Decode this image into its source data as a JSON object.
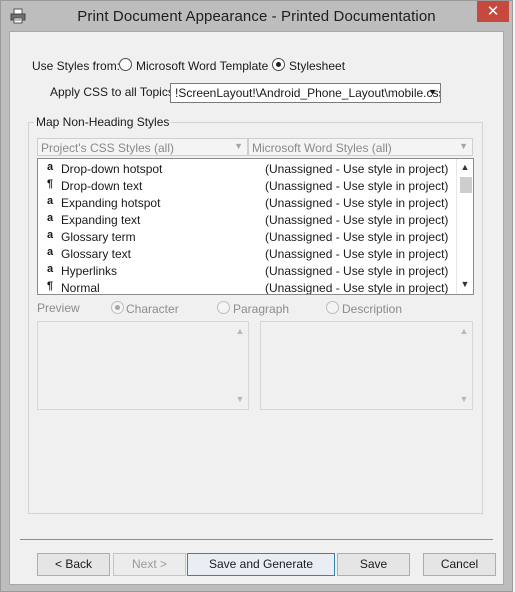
{
  "window": {
    "title": "Print Document Appearance - Printed Documentation",
    "close_label": "✕"
  },
  "use_styles": {
    "label": "Use Styles from:",
    "options": [
      {
        "label": "Microsoft Word Template",
        "checked": false
      },
      {
        "label": "Stylesheet",
        "checked": true
      }
    ]
  },
  "apply_css": {
    "label": "Apply CSS to all Topics:",
    "value": "!ScreenLayout!\\Android_Phone_Layout\\mobile.css"
  },
  "map_group": {
    "title": "Map Non-Heading Styles",
    "css_styles_filter": "Project's CSS Styles (all)",
    "word_styles_filter": "Microsoft Word Styles (all)",
    "rows": [
      {
        "icon": "character-style-icon",
        "glyph": "a",
        "name": "Drop-down hotspot",
        "style": "(Unassigned - Use style in project)"
      },
      {
        "icon": "paragraph-style-icon",
        "glyph": "¶",
        "name": "Drop-down text",
        "style": "(Unassigned - Use style in project)"
      },
      {
        "icon": "character-style-icon",
        "glyph": "a",
        "name": "Expanding hotspot",
        "style": "(Unassigned - Use style in project)"
      },
      {
        "icon": "character-style-icon",
        "glyph": "a",
        "name": "Expanding text",
        "style": "(Unassigned - Use style in project)"
      },
      {
        "icon": "character-style-icon",
        "glyph": "a",
        "name": "Glossary term",
        "style": "(Unassigned - Use style in project)"
      },
      {
        "icon": "character-style-icon",
        "glyph": "a",
        "name": "Glossary text",
        "style": "(Unassigned - Use style in project)"
      },
      {
        "icon": "character-style-icon",
        "glyph": "a",
        "name": "Hyperlinks",
        "style": "(Unassigned - Use style in project)"
      },
      {
        "icon": "paragraph-style-icon",
        "glyph": "¶",
        "name": "Normal",
        "style": "(Unassigned - Use style in project)"
      }
    ]
  },
  "preview": {
    "label": "Preview",
    "options": [
      {
        "label": "Character",
        "checked": true
      },
      {
        "label": "Paragraph",
        "checked": false
      },
      {
        "label": "Description",
        "checked": false
      }
    ]
  },
  "buttons": {
    "back": "< Back",
    "next": "Next >",
    "save_generate": "Save and Generate",
    "save": "Save",
    "cancel": "Cancel"
  },
  "colors": {
    "chrome": "#bdbdbd",
    "close_button": "#c7483d",
    "dialog_bg": "#f0f0f0",
    "default_button_border": "#3c7fb1"
  }
}
